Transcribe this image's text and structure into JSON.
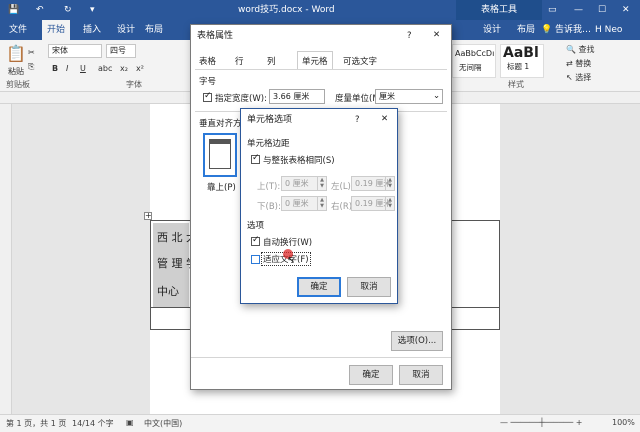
{
  "window": {
    "title": "word技巧.docx - Word",
    "context_tab": "表格工具",
    "help_icon": "?",
    "user": "H Neo",
    "share": "共享",
    "tell_me": "告诉我…"
  },
  "tabs": [
    "文件",
    "开始",
    "插入",
    "设计",
    "布局",
    "设计",
    "布局"
  ],
  "ribbon": {
    "paste": "粘贴",
    "clipboard": "剪贴板",
    "font_name": "宋体",
    "font_size": "四号",
    "font_group": "字体",
    "styles_group": "样式",
    "style1_preview": "AaBbCcDı",
    "style1_name": "无间隔",
    "style2_preview": "AaBl",
    "style2_name": "标题 1",
    "find": "查找",
    "replace": "替换",
    "select": "选择"
  },
  "document": {
    "cell_text": [
      "西 北 大",
      "管 理 学",
      "中心"
    ]
  },
  "status": {
    "page": "第 1 页，共 1 页",
    "words": "14/14 个字",
    "lang": "中文(中国)",
    "zoom": "100%"
  },
  "table_props": {
    "title": "表格属性",
    "tabs": [
      "表格",
      "行",
      "列",
      "单元格",
      "可选文字"
    ],
    "active_tab": 3,
    "size_section": "字号",
    "preferred_width_label": "指定宽度(W):",
    "preferred_width": "3.66 厘米",
    "measure_label": "度量单位(M):",
    "measure": "厘米",
    "valign_label": "垂直对齐方式",
    "valign_top": "靠上(P)",
    "options_button": "选项(O)...",
    "ok": "确定",
    "cancel": "取消"
  },
  "cell_options": {
    "title": "单元格选项",
    "margins_section": "单元格边距",
    "same_as_table": "与整张表格相同(S)",
    "top_label": "上(T):",
    "top_value": "0 厘米",
    "left_label": "左(L):",
    "left_value": "0.19 厘米",
    "bottom_label": "下(B):",
    "bottom_value": "0 厘米",
    "right_label": "右(R):",
    "right_value": "0.19 厘米",
    "options_section": "选项",
    "wrap_text": "自动换行(W)",
    "fit_text": "适应文字(F)",
    "ok": "确定",
    "cancel": "取消"
  }
}
